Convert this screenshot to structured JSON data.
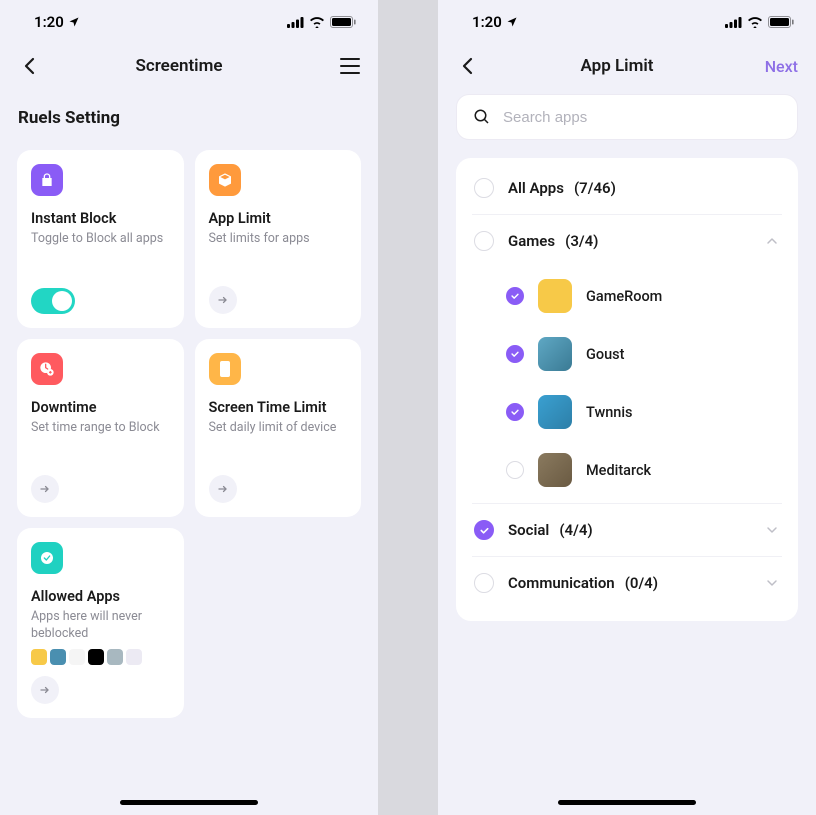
{
  "status": {
    "time": "1:20"
  },
  "left": {
    "title": "Screentime",
    "section": "Ruels Setting",
    "cards": [
      {
        "title": "Instant Block",
        "desc": "Toggle to Block all apps",
        "iconBg": "#8a5cf6"
      },
      {
        "title": "App Limit",
        "desc": "Set limits for apps",
        "iconBg": "#ff9a3c"
      },
      {
        "title": "Downtime",
        "desc": "Set time range to Block",
        "iconBg": "#ff5a5f"
      },
      {
        "title": "Screen Time Limit",
        "desc": "Set daily limit of device",
        "iconBg": "#ffb648"
      },
      {
        "title": "Allowed Apps",
        "desc": "Apps here will never beblocked",
        "iconBg": "#1fd1c1"
      }
    ]
  },
  "right": {
    "title": "App  Limit",
    "next": "Next",
    "searchPlaceholder": "Search apps",
    "allApps": {
      "label": "All Apps",
      "count": "(7/46)"
    },
    "categories": [
      {
        "label": "Games",
        "count": "(3/4)",
        "expanded": true,
        "checked": false,
        "items": [
          {
            "name": "GameRoom",
            "checked": true,
            "bg": "#f7c948"
          },
          {
            "name": "Goust",
            "checked": true,
            "bg": "#4a8fb0"
          },
          {
            "name": "Twnnis",
            "checked": true,
            "bg": "#3aa0d1"
          },
          {
            "name": "Meditarck",
            "checked": false,
            "bg": "#7a6a52"
          }
        ]
      },
      {
        "label": "Social",
        "count": "(4/4)",
        "expanded": false,
        "checked": true
      },
      {
        "label": "Communication",
        "count": "(0/4)",
        "expanded": false,
        "checked": false
      }
    ]
  }
}
